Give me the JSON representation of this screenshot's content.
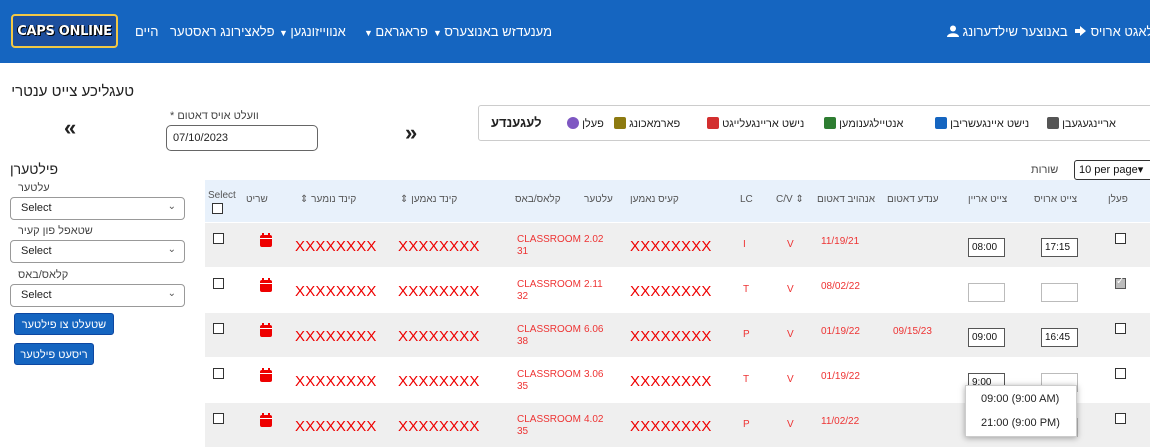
{
  "navbar": {
    "logo": "CAPS ONLINE",
    "items": [
      {
        "label": "היים",
        "caret": false
      },
      {
        "label": "פלאצירונג ראסטער",
        "caret": false
      },
      {
        "label": "אנווײזונגען",
        "caret": true
      },
      {
        "label": "פראגראם",
        "caret": true
      },
      {
        "label": "מענעדזש באנוצערס",
        "caret": false
      }
    ],
    "user_settings": "באנוצער שילדערונג",
    "logout": "לאגט ארויס"
  },
  "page_title": "טעגליכע צייט ענטרי",
  "date_nav": {
    "prev": "«",
    "next": "»",
    "label": "* וועלט אויס דאטום",
    "value": "07/10/2023"
  },
  "legend": {
    "title": "לעגענדע",
    "items": [
      "פעלן",
      "פארמאכונג",
      "נישט אריינגעלייגט",
      "אנטיילגענומען",
      "נישט איינגעשריבן",
      "אריינגעגעבן"
    ],
    "colors": [
      "#7e57c2",
      "#8d7a10",
      "#d32f2f",
      "#2e7d32",
      "#1565c0",
      "#555555"
    ]
  },
  "filters": {
    "title": "פילטערן",
    "fields": [
      {
        "label": "עלטער",
        "value": "Select"
      },
      {
        "label": "שטאפל פון קעיר",
        "value": "Select"
      },
      {
        "label": "קלאס/באס",
        "value": "Select"
      }
    ],
    "apply": "שטעלט צו פילטער",
    "reset": "ריסעט פילטער"
  },
  "rows_per_page": {
    "label": "שורות",
    "value": "10 per page"
  },
  "table": {
    "headers": {
      "select": "Select",
      "icon": "שריט",
      "child_number": "⇕ קינד נומער",
      "child_name": "⇕ קינד נאמען",
      "class": "קלאס/באס",
      "age": "עלטער",
      "case_name": "קעיס נאמען",
      "lc": "LC",
      "cv": "C/V ⇕",
      "start_date": "אנהויב דאטום",
      "end_date": "ענדע דאטום",
      "time_in": "צייט ארײן",
      "time_out": "צייט ארויס",
      "absent": "פעלן"
    },
    "rows": [
      {
        "num": "XXXXXXXX",
        "name": "XXXXXXXX",
        "class": "CLASSROOM",
        "class2": "31",
        "age": "2.02",
        "case": "XXXXXXXX",
        "lc": "I",
        "cv": "V",
        "start": "11/19/21",
        "end": "",
        "in": "08:00",
        "out": "17:15",
        "absent": false
      },
      {
        "num": "XXXXXXXX",
        "name": "XXXXXXXX",
        "class": "CLASSROOM",
        "class2": "32",
        "age": "2.11",
        "case": "XXXXXXXX",
        "lc": "T",
        "cv": "V",
        "start": "08/02/22",
        "end": "",
        "in": "",
        "out": "",
        "absent": true
      },
      {
        "num": "XXXXXXXX",
        "name": "XXXXXXXX",
        "class": "CLASSROOM",
        "class2": "38",
        "age": "6.06",
        "case": "XXXXXXXX",
        "lc": "P",
        "cv": "V",
        "start": "01/19/22",
        "end": "09/15/23",
        "in": "09:00",
        "out": "16:45",
        "absent": false
      },
      {
        "num": "XXXXXXXX",
        "name": "XXXXXXXX",
        "class": "CLASSROOM",
        "class2": "35",
        "age": "3.06",
        "case": "XXXXXXXX",
        "lc": "T",
        "cv": "V",
        "start": "01/19/22",
        "end": "",
        "in": "9:00",
        "out": "",
        "absent": false
      },
      {
        "num": "XXXXXXXX",
        "name": "XXXXXXXX",
        "class": "CLASSROOM",
        "class2": "35",
        "age": "4.02",
        "case": "XXXXXXXX",
        "lc": "P",
        "cv": "V",
        "start": "11/02/22",
        "end": "",
        "in": "",
        "out": "",
        "absent": false
      }
    ]
  },
  "time_dropdown": {
    "options": [
      "09:00 (9:00 AM)",
      "21:00 (9:00 PM)"
    ]
  }
}
